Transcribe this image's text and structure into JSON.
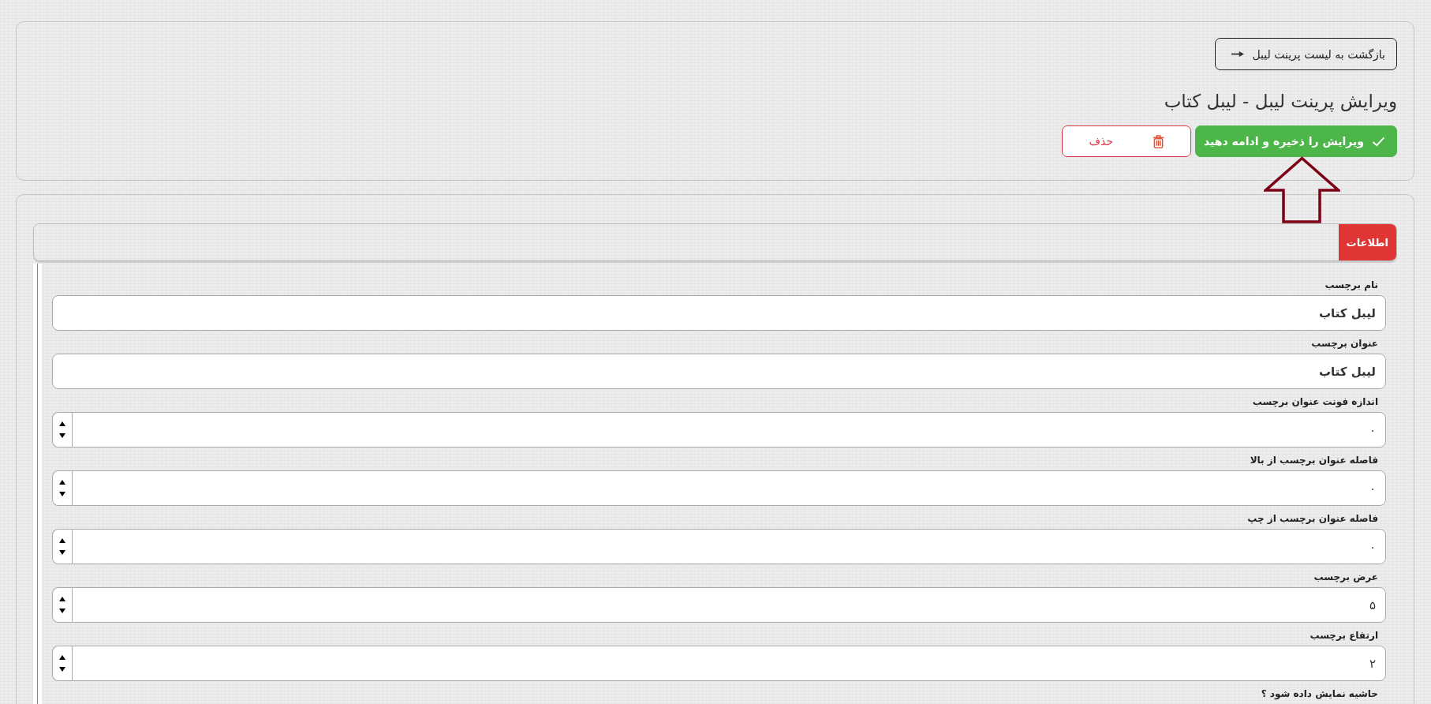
{
  "header": {
    "back_button": {
      "label": "بازگشت به لیست پرینت لیبل"
    },
    "title": "ویرایش پرینت لیبل - لیبل کتاب",
    "actions": [
      {
        "kind": "save",
        "label": "ویرایش را ذخیره و ادامه دهید"
      },
      {
        "kind": "delete",
        "label": "حذف"
      }
    ]
  },
  "tabs": [
    {
      "label": "اطلاعات",
      "selected": true
    }
  ],
  "form": {
    "fields": [
      {
        "kind": "text",
        "label": "نام برچسب",
        "value": "لیبل کتاب"
      },
      {
        "kind": "text",
        "label": "عنوان برچسب",
        "value": "لیبل کتاب"
      },
      {
        "kind": "number",
        "label": "اندازه فونت عنوان برچسب",
        "value": "۰"
      },
      {
        "kind": "number",
        "label": "فاصله عنوان برچسب از بالا",
        "value": "۰"
      },
      {
        "kind": "number",
        "label": "فاصله عنوان برچسب از چپ",
        "value": "۰"
      },
      {
        "kind": "number",
        "label": "عرض برچسب",
        "value": "۵"
      },
      {
        "kind": "number",
        "label": "ارتفاع برچسب",
        "value": "۲"
      },
      {
        "kind": "cut_off",
        "label": "حاشیه نمایش داده شود ؟"
      }
    ]
  }
}
